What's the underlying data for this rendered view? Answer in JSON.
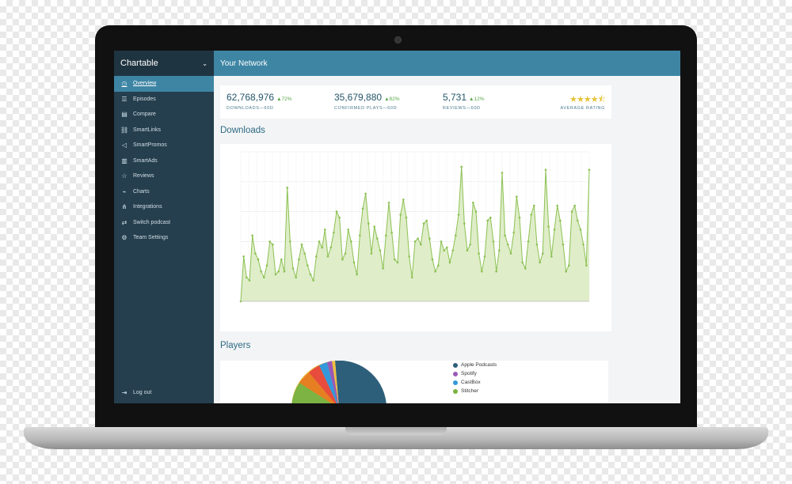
{
  "sidebar": {
    "brand": "Chartable",
    "items": [
      {
        "label": "Overview",
        "icon": "clock-icon",
        "active": true
      },
      {
        "label": "Episodes",
        "icon": "list-icon"
      },
      {
        "label": "Compare",
        "icon": "compare-icon"
      },
      {
        "label": "SmartLinks",
        "icon": "link-icon"
      },
      {
        "label": "SmartPromos",
        "icon": "megaphone-icon"
      },
      {
        "label": "SmartAds",
        "icon": "ads-icon"
      },
      {
        "label": "Reviews",
        "icon": "star-icon"
      },
      {
        "label": "Charts",
        "icon": "chart-icon"
      },
      {
        "label": "Integrations",
        "icon": "integrations-icon"
      },
      {
        "label": "Switch podcast",
        "icon": "switch-icon"
      },
      {
        "label": "Team Settings",
        "icon": "gear-icon"
      }
    ],
    "logout": "Log out"
  },
  "header": {
    "title": "Your Network"
  },
  "stats": [
    {
      "value": "62,768,976",
      "delta": "▲72%",
      "label": "DOWNLOADS—60D"
    },
    {
      "value": "35,679,880",
      "delta": "▲82%",
      "label": "CONFIRMED PLAYS—60D"
    },
    {
      "value": "5,731",
      "delta": "▲12%",
      "label": "REVIEWS—60D"
    }
  ],
  "rating": {
    "stars": "★★★★⯪",
    "label": "AVERAGE RATING",
    "value": 4.5
  },
  "downloads": {
    "title": "Downloads"
  },
  "players": {
    "title": "Players",
    "legend": [
      {
        "name": "Apple Podcasts",
        "color": "#2e5f7a"
      },
      {
        "name": "Spotify",
        "color": "#9b59b6"
      },
      {
        "name": "CastBox",
        "color": "#3498db"
      },
      {
        "name": "Stitcher",
        "color": "#7cb342"
      }
    ]
  },
  "colors": {
    "accent": "#3e85a4",
    "sidebar": "#253f4e",
    "chart_line": "#8cc152",
    "chart_fill": "#dfedc9"
  },
  "chart_data": {
    "type": "area",
    "values": [
      0,
      15,
      8,
      7,
      22,
      16,
      14,
      10,
      8,
      12,
      20,
      19,
      9,
      10,
      14,
      10,
      38,
      20,
      11,
      8,
      14,
      19,
      16,
      12,
      9,
      7,
      15,
      20,
      18,
      24,
      15,
      18,
      23,
      30,
      28,
      14,
      16,
      24,
      20,
      13,
      9,
      22,
      31,
      36,
      26,
      16,
      25,
      21,
      17,
      11,
      22,
      33,
      23,
      14,
      13,
      29,
      34,
      28,
      15,
      8,
      20,
      21,
      19,
      26,
      27,
      21,
      14,
      10,
      12,
      20,
      17,
      18,
      13,
      17,
      22,
      29,
      45,
      26,
      17,
      19,
      33,
      30,
      16,
      10,
      15,
      27,
      28,
      20,
      10,
      17,
      43,
      22,
      19,
      16,
      23,
      35,
      28,
      13,
      11,
      20,
      29,
      32,
      19,
      13,
      16,
      44,
      25,
      15,
      24,
      32,
      27,
      19,
      10,
      12,
      30,
      32,
      27,
      24,
      19,
      12,
      44
    ],
    "ylim": [
      0,
      50
    ],
    "grid": true
  }
}
